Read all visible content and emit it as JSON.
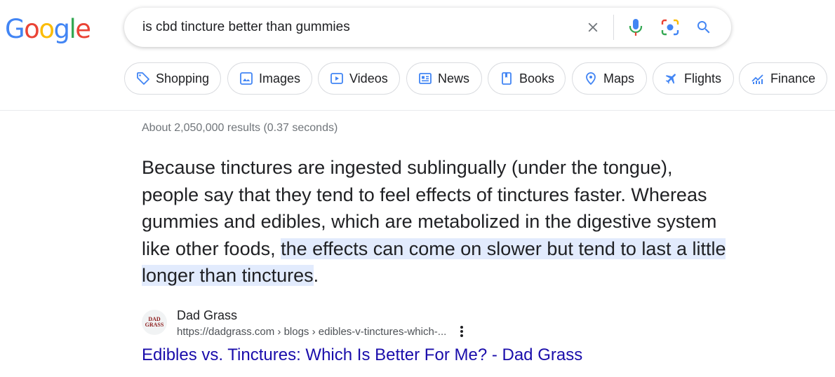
{
  "logo": {
    "letters": [
      "G",
      "o",
      "o",
      "g",
      "l",
      "e"
    ]
  },
  "search": {
    "query": "is cbd tincture better than gummies"
  },
  "icons": {
    "clear": "close-icon",
    "voice": "microphone-icon",
    "lens": "camera-lens-icon",
    "search": "search-icon",
    "more": "more-vert-icon"
  },
  "colors": {
    "blue": "#4285f4",
    "red": "#ea4335",
    "yellow": "#fbbc05",
    "green": "#34a853",
    "link": "#1a0dab",
    "highlight": "#e2ebfd"
  },
  "chips": [
    {
      "label": "Shopping",
      "icon": "tag-icon"
    },
    {
      "label": "Images",
      "icon": "image-icon"
    },
    {
      "label": "Videos",
      "icon": "play-icon"
    },
    {
      "label": "News",
      "icon": "newspaper-icon"
    },
    {
      "label": "Books",
      "icon": "book-icon"
    },
    {
      "label": "Maps",
      "icon": "map-pin-icon"
    },
    {
      "label": "Flights",
      "icon": "airplane-icon"
    },
    {
      "label": "Finance",
      "icon": "finance-chart-icon"
    }
  ],
  "stats": "About 2,050,000 results (0.37 seconds)",
  "snippet": {
    "plain": "Because tinctures are ingested sublingually (under the tongue), people say that they tend to feel effects of tinctures faster. Whereas gummies and edibles, which are metabolized in the digestive system like other foods, ",
    "highlight": "the effects can come on slower but tend to last a little longer than tinctures",
    "tail": "."
  },
  "source": {
    "favicon_text_line1": "DAD",
    "favicon_text_line2": "GRASS",
    "name": "Dad Grass",
    "url": "https://dadgrass.com › blogs › edibles-v-tinctures-which-...",
    "title": "Edibles vs. Tinctures: Which Is Better For Me? - Dad Grass"
  }
}
